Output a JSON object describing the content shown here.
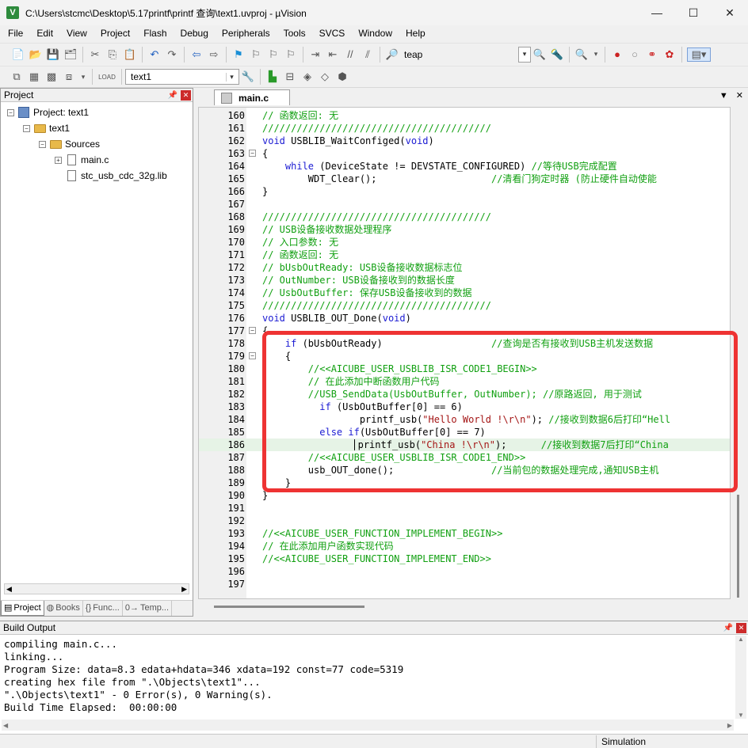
{
  "window": {
    "title": "C:\\Users\\stcmc\\Desktop\\5.17printf\\printf 查询\\text1.uvproj - µVision",
    "app_icon_letter": "V"
  },
  "window_controls": {
    "minimize": "—",
    "maximize": "☐",
    "close": "✕"
  },
  "menu": [
    "File",
    "Edit",
    "View",
    "Project",
    "Flash",
    "Debug",
    "Peripherals",
    "Tools",
    "SVCS",
    "Window",
    "Help"
  ],
  "toolbar1": {
    "find_text": "teap"
  },
  "toolbar2": {
    "target": "text1",
    "load_label": "LOAD"
  },
  "project_panel": {
    "title": "Project",
    "tree": {
      "root": "Project: text1",
      "target": "text1",
      "group": "Sources",
      "files": [
        "main.c",
        "stc_usb_cdc_32g.lib"
      ]
    },
    "tabs": [
      {
        "icon": "▤",
        "label": "Project"
      },
      {
        "icon": "◍",
        "label": "Books"
      },
      {
        "icon": "{}",
        "label": "Func..."
      },
      {
        "icon": "0→",
        "label": "Temp..."
      }
    ]
  },
  "editor": {
    "tab_label": "main.c",
    "lines": [
      {
        "n": "160",
        "segs": [
          [
            "cmt",
            "// 函数返回: 无"
          ]
        ]
      },
      {
        "n": "161",
        "segs": [
          [
            "cmt",
            "////////////////////////////////////////"
          ]
        ]
      },
      {
        "n": "162",
        "segs": [
          [
            "kw",
            "void"
          ],
          [
            "",
            " USBLIB_WaitConfiged("
          ],
          [
            "kw",
            "void"
          ],
          [
            "",
            ")"
          ]
        ]
      },
      {
        "n": "163",
        "fold": "-",
        "segs": [
          [
            "",
            "{"
          ]
        ]
      },
      {
        "n": "164",
        "segs": [
          [
            "",
            "    "
          ],
          [
            "kw",
            "while"
          ],
          [
            "",
            " (DeviceState != DEVSTATE_CONFIGURED) "
          ],
          [
            "cmt",
            "//等待USB完成配置"
          ]
        ]
      },
      {
        "n": "165",
        "segs": [
          [
            "",
            "        WDT_Clear();                    "
          ],
          [
            "cmt",
            "//清看门狗定时器 (防止硬件自动使能"
          ]
        ]
      },
      {
        "n": "166",
        "segs": [
          [
            "",
            "}"
          ]
        ]
      },
      {
        "n": "167",
        "segs": []
      },
      {
        "n": "168",
        "segs": [
          [
            "cmt",
            "////////////////////////////////////////"
          ]
        ]
      },
      {
        "n": "169",
        "segs": [
          [
            "cmt",
            "// USB设备接收数据处理程序"
          ]
        ]
      },
      {
        "n": "170",
        "segs": [
          [
            "cmt",
            "// 入口参数: 无"
          ]
        ]
      },
      {
        "n": "171",
        "segs": [
          [
            "cmt",
            "// 函数返回: 无"
          ]
        ]
      },
      {
        "n": "172",
        "segs": [
          [
            "cmt",
            "// bUsbOutReady: USB设备接收数据标志位"
          ]
        ]
      },
      {
        "n": "173",
        "segs": [
          [
            "cmt",
            "// OutNumber: USB设备接收到的数据长度"
          ]
        ]
      },
      {
        "n": "174",
        "segs": [
          [
            "cmt",
            "// UsbOutBuffer: 保存USB设备接收到的数据"
          ]
        ]
      },
      {
        "n": "175",
        "segs": [
          [
            "cmt",
            "////////////////////////////////////////"
          ]
        ]
      },
      {
        "n": "176",
        "segs": [
          [
            "kw",
            "void"
          ],
          [
            "",
            " USBLIB_OUT_Done("
          ],
          [
            "kw",
            "void"
          ],
          [
            "",
            ")"
          ]
        ]
      },
      {
        "n": "177",
        "fold": "-",
        "segs": [
          [
            "",
            "{"
          ]
        ]
      },
      {
        "n": "178",
        "segs": [
          [
            "",
            "    "
          ],
          [
            "kw",
            "if"
          ],
          [
            "",
            " (bUsbOutReady)                   "
          ],
          [
            "cmt",
            "//查询是否有接收到USB主机发送数据"
          ]
        ]
      },
      {
        "n": "179",
        "fold": "-",
        "segs": [
          [
            "",
            "    {"
          ]
        ]
      },
      {
        "n": "180",
        "segs": [
          [
            "",
            "        "
          ],
          [
            "cmt",
            "//<<AICUBE_USER_USBLIB_ISR_CODE1_BEGIN>>"
          ]
        ]
      },
      {
        "n": "181",
        "segs": [
          [
            "",
            "        "
          ],
          [
            "cmt",
            "// 在此添加中断函数用户代码"
          ]
        ]
      },
      {
        "n": "182",
        "segs": [
          [
            "",
            "        "
          ],
          [
            "cmt",
            "//USB_SendData(UsbOutBuffer, OutNumber); //原路返回, 用于测试"
          ]
        ]
      },
      {
        "n": "183",
        "segs": [
          [
            "",
            "          "
          ],
          [
            "kw",
            "if"
          ],
          [
            "",
            " (UsbOutBuffer[0] == 6)"
          ]
        ]
      },
      {
        "n": "184",
        "segs": [
          [
            "",
            "                 printf_usb("
          ],
          [
            "str",
            "\"Hello World !\\r\\n\""
          ],
          [
            "",
            "); "
          ],
          [
            "cmt",
            "//接收到数据6后打印“Hell"
          ]
        ]
      },
      {
        "n": "185",
        "segs": [
          [
            "",
            "          "
          ],
          [
            "kw",
            "else if"
          ],
          [
            "",
            "(UsbOutBuffer[0] == 7)"
          ]
        ]
      },
      {
        "n": "186",
        "cur": true,
        "segs": [
          [
            "",
            "                "
          ],
          [
            "caret",
            ""
          ],
          [
            "",
            "printf_usb("
          ],
          [
            "str",
            "\"China !\\r\\n\""
          ],
          [
            "",
            ");      "
          ],
          [
            "cmt",
            "//接收到数据7后打印“China"
          ]
        ]
      },
      {
        "n": "187",
        "segs": [
          [
            "",
            "        "
          ],
          [
            "cmt",
            "//<<AICUBE_USER_USBLIB_ISR_CODE1_END>>"
          ]
        ]
      },
      {
        "n": "188",
        "segs": [
          [
            "",
            "        usb_OUT_done();                 "
          ],
          [
            "cmt",
            "//当前包的数据处理完成,通知USB主机"
          ]
        ]
      },
      {
        "n": "189",
        "segs": [
          [
            "",
            "    }"
          ]
        ]
      },
      {
        "n": "190",
        "segs": [
          [
            "",
            "}"
          ]
        ]
      },
      {
        "n": "191",
        "segs": []
      },
      {
        "n": "192",
        "segs": []
      },
      {
        "n": "193",
        "segs": [
          [
            "cmt",
            "//<<AICUBE_USER_FUNCTION_IMPLEMENT_BEGIN>>"
          ]
        ]
      },
      {
        "n": "194",
        "segs": [
          [
            "cmt",
            "// 在此添加用户函数实现代码"
          ]
        ]
      },
      {
        "n": "195",
        "segs": [
          [
            "cmt",
            "//<<AICUBE_USER_FUNCTION_IMPLEMENT_END>>"
          ]
        ]
      },
      {
        "n": "196",
        "segs": []
      },
      {
        "n": "197",
        "segs": []
      }
    ]
  },
  "build_output": {
    "title": "Build Output",
    "text": "compiling main.c...\nlinking...\nProgram Size: data=8.3 edata+hdata=346 xdata=192 const=77 code=5319\ncreating hex file from \".\\Objects\\text1\"...\n\".\\Objects\\text1\" - 0 Error(s), 0 Warning(s).\nBuild Time Elapsed:  00:00:00"
  },
  "status": {
    "mode": "Simulation"
  },
  "colors": {
    "comment": "#11a011",
    "keyword": "#1b1bd3",
    "string": "#a41515",
    "highlight_border": "#ee3333"
  }
}
